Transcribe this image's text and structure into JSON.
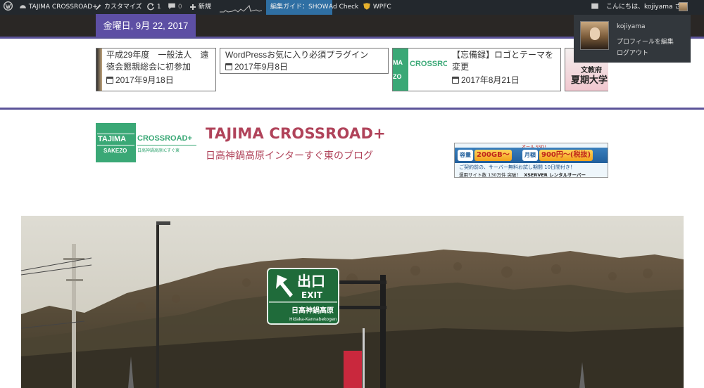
{
  "admin_bar": {
    "site_name": "TAJIMA CROSSROAD+",
    "customize": "カスタマイズ",
    "updates_count": "1",
    "comments_count": "0",
    "new_label": "新規",
    "guide_label": "編集ガイド：SHOW",
    "ad_check": "Ad Check",
    "wpfc": "WPFC",
    "greeting": "こんにちは、kojiyama さん"
  },
  "profile_menu": {
    "name": "kojiyama",
    "edit_profile": "プロフィールを編集",
    "logout": "ログアウト"
  },
  "header": {
    "date": "金曜日, 9月 22, 2017"
  },
  "carousel": {
    "cards": [
      {
        "title": "平成29年度　一般法人　遠徳会懇親総会に初参加",
        "date": "2017年9月18日"
      },
      {
        "title": "WordPressお気に入り必須プラグイン",
        "date": "2017年9月8日"
      },
      {
        "title": "【忘備録】ロゴとテーマを変更",
        "date": "2017年8月21日"
      }
    ],
    "card4_thumb": {
      "line1": "第50回",
      "line2": "文教府",
      "line3": "夏期大学"
    },
    "card3_thumb": {
      "brand": "CROSSRO",
      "left": "MA",
      "sub": "ZO"
    }
  },
  "branding": {
    "logo_word1": "TAJIMA",
    "logo_word2": "SAKEZO",
    "logo_word3": "CROSSROAD+",
    "logo_sub": "日高神鍋高原ICすぐ東",
    "title": "TAJIMA CROSSROAD+",
    "tagline": "日高神鍋高原インターすぐ東のブログ"
  },
  "ad_banner": {
    "ribbon": "オール SSD!",
    "capacity_label": "容量",
    "capacity": "200GB～",
    "monthly_label": "月額",
    "price": "900円～(税抜)",
    "trial": "ご契約前の、サーバー無料お試し期間 10日間付き！",
    "sites": "運用サイト数 130万件 突破！",
    "brand": "XSERVER レンタルサーバー"
  },
  "hero_sign": {
    "exit_jp": "出口",
    "exit_en": "EXIT",
    "place_jp": "日高神鍋高原",
    "place_en": "Hidaka-Kannabekogen"
  },
  "colors": {
    "accent": "#5d4fa4",
    "title": "#b0435a",
    "admin_bar": "#23282d",
    "sign_green": "#1f6b3a"
  }
}
